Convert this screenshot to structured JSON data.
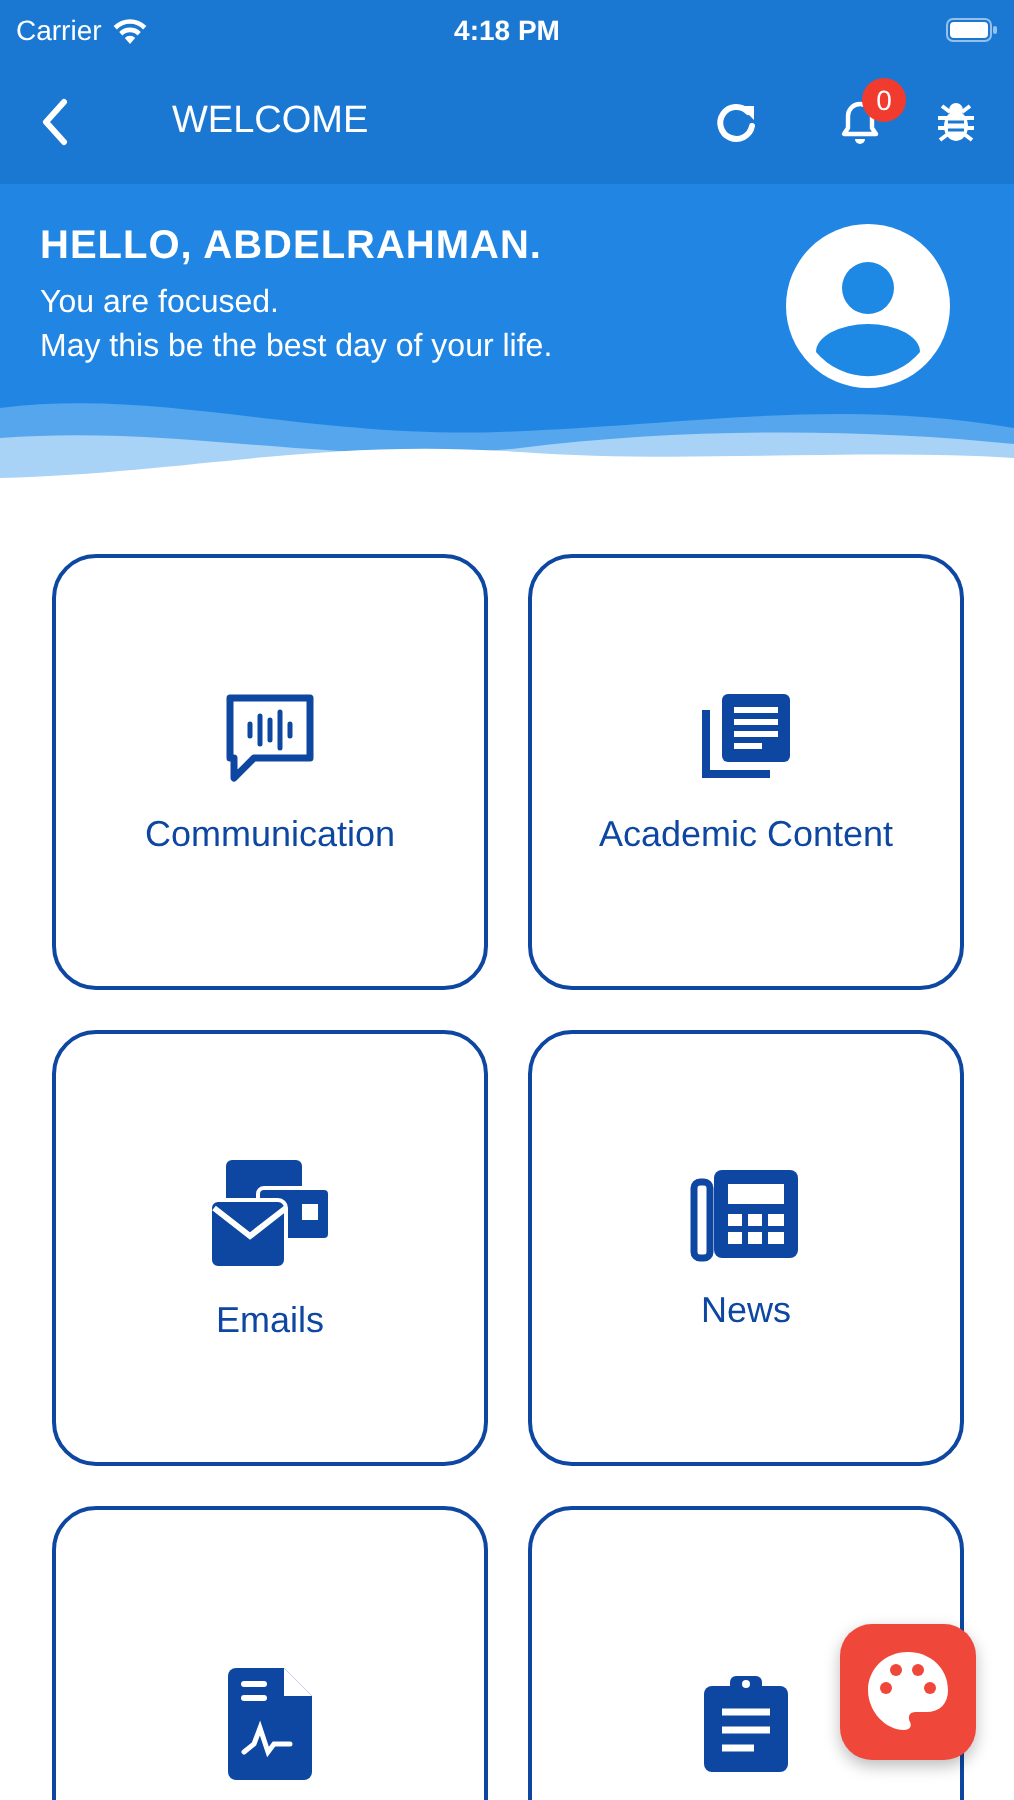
{
  "status_bar": {
    "carrier": "Carrier",
    "time": "4:18 PM"
  },
  "nav": {
    "title": "WELCOME",
    "notification_count": "0"
  },
  "header": {
    "greeting": "HELLO, ABDELRAHMAN.",
    "lines": [
      "You are focused.",
      "May this be the best day of your life."
    ]
  },
  "cards": [
    {
      "kind": "communication",
      "label": "Communication"
    },
    {
      "kind": "academic",
      "label": "Academic Content"
    },
    {
      "kind": "emails",
      "label": "Emails"
    },
    {
      "kind": "news",
      "label": "News"
    },
    {
      "kind": "document"
    },
    {
      "kind": "clipboard"
    }
  ]
}
